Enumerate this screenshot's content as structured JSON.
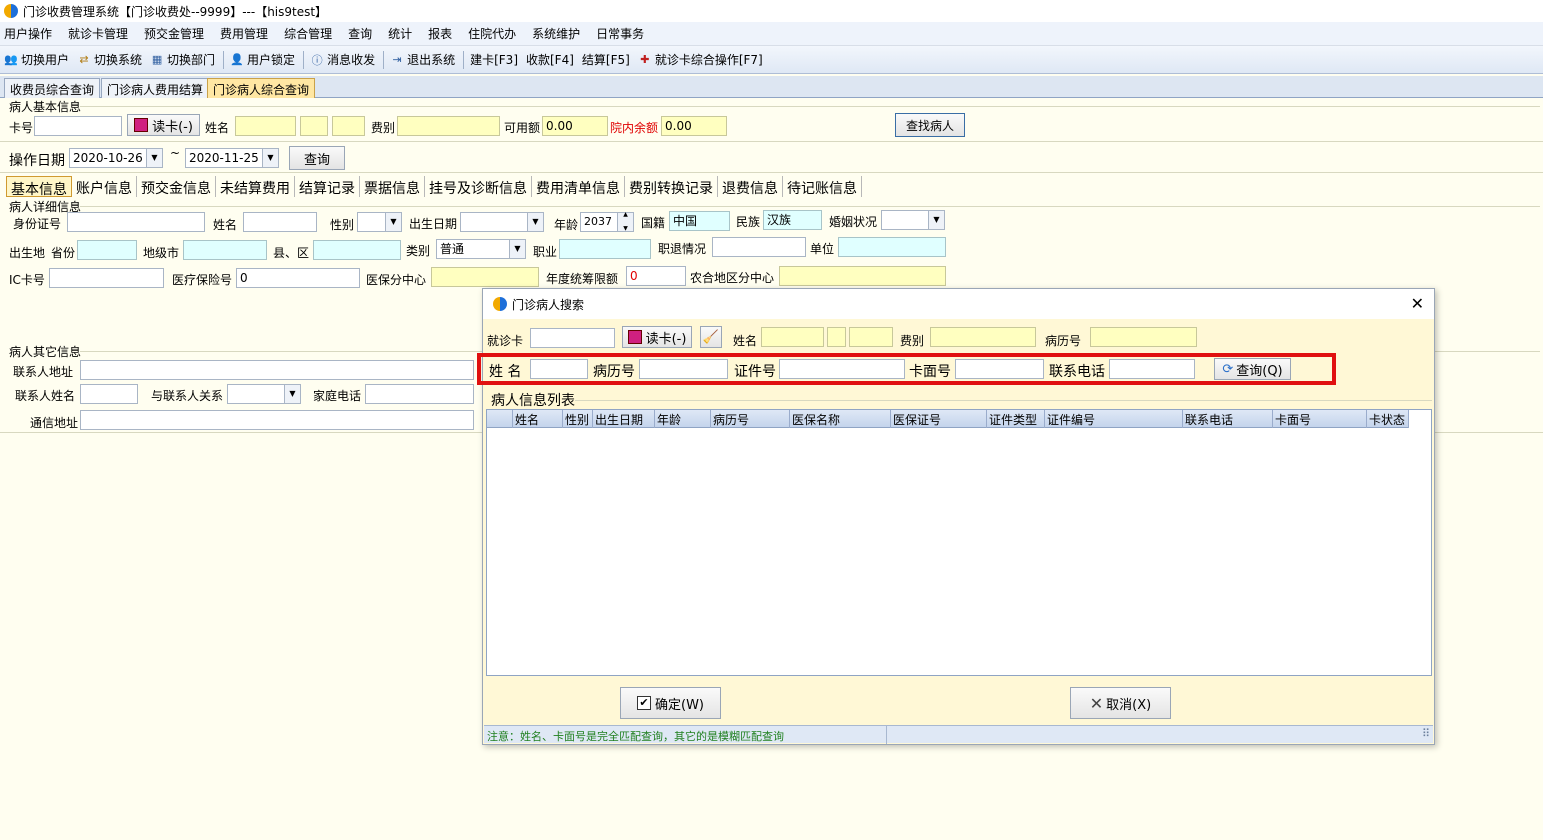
{
  "window": {
    "title": "门诊收费管理系统【门诊收费处--9999】---【his9test】"
  },
  "menu": [
    "用户操作",
    "就诊卡管理",
    "预交金管理",
    "费用管理",
    "综合管理",
    "查询",
    "统计",
    "报表",
    "住院代办",
    "系统维护",
    "日常事务"
  ],
  "toolbar": {
    "switch_user": "切换用户",
    "switch_system": "切换系统",
    "switch_dept": "切换部门",
    "lock_user": "用户锁定",
    "messages": "消息收发",
    "exit": "退出系统",
    "create_card": "建卡[F3]",
    "charge": "收款[F4]",
    "settle": "结算[F5]",
    "card_ops": "就诊卡综合操作[F7]"
  },
  "doc_tabs": [
    "收费员综合查询",
    "门诊病人费用结算",
    "门诊病人综合查询"
  ],
  "basic": {
    "group": "病人基本信息",
    "card_label": "卡号",
    "read_card": "读卡(-)",
    "name_label": "姓名",
    "fee_type_label": "费别",
    "available_label": "可用额",
    "available_value": "0.00",
    "hospital_balance_label": "院内余额",
    "hospital_balance_value": "0.00",
    "find_patient": "查找病人",
    "op_date_label": "操作日期",
    "date_from": "2020-10-26",
    "tilde": "~",
    "date_to": "2020-11-25",
    "query": "查询"
  },
  "sub_tabs": [
    "基本信息",
    "账户信息",
    "预交金信息",
    "未结算费用",
    "结算记录",
    "票据信息",
    "挂号及诊断信息",
    "费用清单信息",
    "费别转换记录",
    "退费信息",
    "待记账信息"
  ],
  "detail": {
    "group": "病人详细信息",
    "id_no": "身份证号",
    "name": "姓名",
    "gender": "性别",
    "birth_date": "出生日期",
    "age": "年龄",
    "age_value": "2037",
    "nationality": "国籍",
    "nationality_value": "中国",
    "ethnicity": "民族",
    "ethnicity_value": "汉族",
    "marital": "婚姻状况",
    "birthplace": "出生地",
    "province": "省份",
    "city": "地级市",
    "county": "县、区",
    "category": "类别",
    "category_value": "普通",
    "occupation": "职业",
    "retirement": "职退情况",
    "employer": "单位",
    "ic_card": "IC卡号",
    "insurance_no": "医疗保险号",
    "insurance_value": "0",
    "insurance_center": "医保分中心",
    "annual_limit": "年度统筹限额",
    "annual_limit_value": "0",
    "rural_center": "农合地区分中心"
  },
  "other": {
    "group": "病人其它信息",
    "contact_address": "联系人地址",
    "contact_name": "联系人姓名",
    "relation": "与联系人关系",
    "home_phone": "家庭电话",
    "mail_address": "通信地址"
  },
  "dialog": {
    "title": "门诊病人搜索",
    "card": "就诊卡",
    "read_card": "读卡(-)",
    "name": "姓名",
    "fee_type": "费别",
    "record_no": "病历号",
    "s_name": "姓 名",
    "s_record": "病历号",
    "s_id": "证件号",
    "s_card_face": "卡面号",
    "s_phone": "联系电话",
    "query": "查询(Q)",
    "list_title": "病人信息列表",
    "columns": [
      "姓名",
      "性别",
      "出生日期",
      "年龄",
      "病历号",
      "医保名称",
      "医保证号",
      "证件类型",
      "证件编号",
      "联系电话",
      "卡面号",
      "卡状态"
    ],
    "ok": "确定(W)",
    "cancel": "取消(X)",
    "status": "注意：姓名、卡面号是完全匹配查询，其它的是模糊匹配查询"
  }
}
